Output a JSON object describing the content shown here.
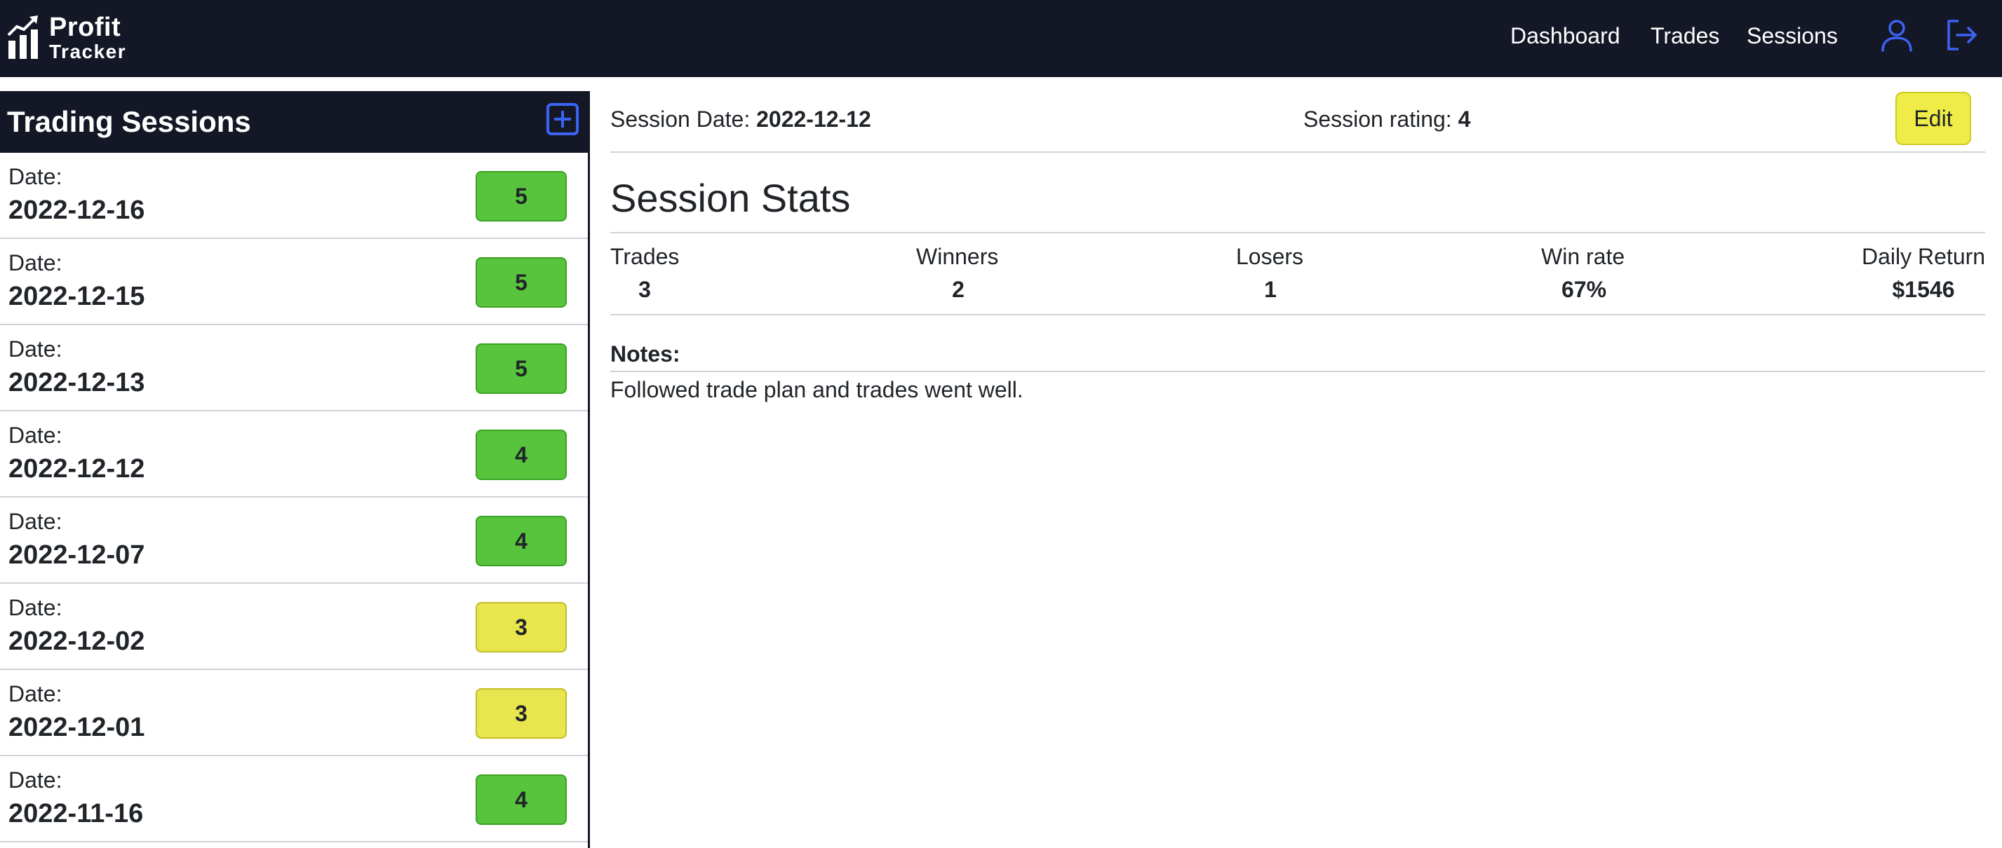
{
  "brand": {
    "line1": "Profit",
    "line2": "Tracker"
  },
  "nav": {
    "dashboard": "Dashboard",
    "trades": "Trades",
    "sessions": "Sessions"
  },
  "sidebar": {
    "title": "Trading Sessions",
    "items": [
      {
        "label": "Date:",
        "date": "2022-12-16",
        "rating": "5",
        "rating_color": "#58c43d"
      },
      {
        "label": "Date:",
        "date": "2022-12-15",
        "rating": "5",
        "rating_color": "#58c43d"
      },
      {
        "label": "Date:",
        "date": "2022-12-13",
        "rating": "5",
        "rating_color": "#58c43d"
      },
      {
        "label": "Date:",
        "date": "2022-12-12",
        "rating": "4",
        "rating_color": "#58c43d"
      },
      {
        "label": "Date:",
        "date": "2022-12-07",
        "rating": "4",
        "rating_color": "#58c43d"
      },
      {
        "label": "Date:",
        "date": "2022-12-02",
        "rating": "3",
        "rating_color": "#e8e54e"
      },
      {
        "label": "Date:",
        "date": "2022-12-01",
        "rating": "3",
        "rating_color": "#e8e54e"
      },
      {
        "label": "Date:",
        "date": "2022-11-16",
        "rating": "4",
        "rating_color": "#58c43d"
      }
    ]
  },
  "session": {
    "date_label": "Session Date:",
    "date": "2022-12-12",
    "rating_label": "Session rating:",
    "rating": "4",
    "edit_label": "Edit"
  },
  "stats": {
    "title": "Session Stats",
    "columns": [
      {
        "label": "Trades",
        "value": "3"
      },
      {
        "label": "Winners",
        "value": "2"
      },
      {
        "label": "Losers",
        "value": "1"
      },
      {
        "label": "Win rate",
        "value": "67%"
      },
      {
        "label": "Daily Return",
        "value": "$1546"
      }
    ]
  },
  "notes": {
    "label": "Notes:",
    "text": "Followed trade plan and trades went well."
  },
  "icons": {
    "brand": "bar-chart-trend-icon",
    "user": "user-icon",
    "logout": "logout-icon",
    "add": "plus-square-icon"
  },
  "colors": {
    "navbar": "#141826",
    "accent": "#3b63f5",
    "edit": "#f0ec47"
  }
}
